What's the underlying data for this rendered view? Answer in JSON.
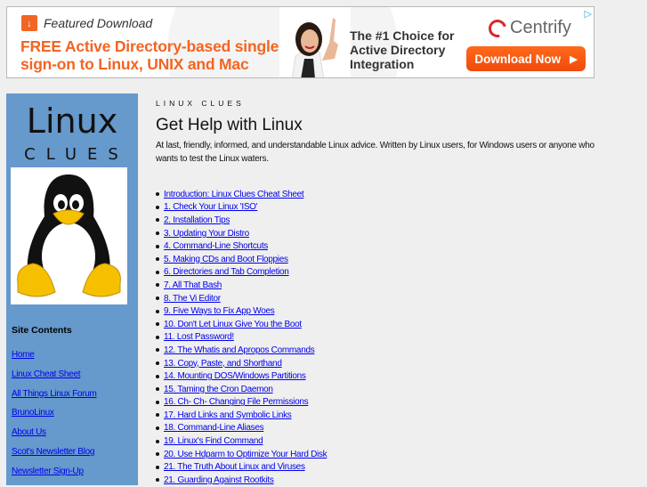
{
  "ad": {
    "featured_label": "Featured Download",
    "headline": "FREE Active Directory-based single sign-on to Linux, UNIX and Mac",
    "tagline": "The #1 Choice for Active Directory Integration",
    "brand": "Centrify",
    "cta_label": "Download Now",
    "cta_arrow": "▶",
    "adchoices_glyph": "▷",
    "download_glyph": "↓",
    "colors": {
      "accent": "#f26522",
      "brand_red": "#d8262e"
    }
  },
  "sidebar": {
    "logo_title": "Linux",
    "logo_subtitle": "CLUES",
    "heading": "Site Contents",
    "links": [
      "Home",
      "Linux Cheat Sheet",
      "All Things Linux Forum",
      "BrunoLinux",
      "About Us",
      "Scot's Newsletter Blog",
      "Newsletter Sign-Up"
    ],
    "background": "#6699cc"
  },
  "main": {
    "kicker": "LINUX CLUES",
    "title": "Get Help with Linux",
    "intro": "At last, friendly, informed, and understandable Linux advice. Written by Linux users, for Windows users or anyone who wants to test the Linux waters.",
    "toc": [
      "Introduction: Linux Clues Cheat Sheet",
      "1. Check Your Linux 'ISO'",
      "2. Installation Tips",
      "3. Updating Your Distro",
      "4. Command-Line Shortcuts",
      "5. Making CDs and Boot Floppies",
      "6. Directories and Tab Completion",
      "7. All That Bash",
      "8. The Vi Editor",
      "9. Five Ways to Fix App Woes",
      "10. Don't Let Linux Give You the Boot",
      "11. Lost Password!",
      "12. The Whatis and Apropos Commands",
      "13. Copy, Paste, and Shorthand",
      "14. Mounting DOS/Windows Partitions",
      "15. Taming the Cron Daemon",
      "16. Ch- Ch- Changing File Permissions",
      "17. Hard Links and Symbolic Links",
      "18. Command-Line Aliases",
      "19. Linux's Find Command",
      "20. Use Hdparm to Optimize Your Hard Disk",
      "21. The Truth About Linux and Viruses",
      "21. Guarding Against Rootkits"
    ],
    "link_color": "#0000ee"
  }
}
